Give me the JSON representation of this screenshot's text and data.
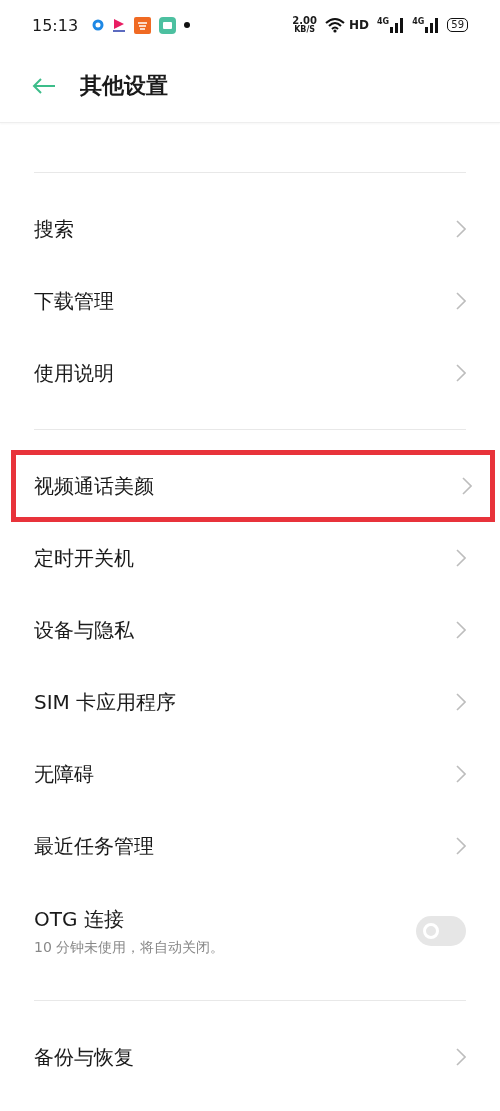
{
  "status_bar": {
    "time": "15:13",
    "speed": "2.00",
    "speed_unit": "KB/S",
    "hd": "HD",
    "sim1": "4G",
    "sim2": "4G",
    "battery": "59"
  },
  "header": {
    "title": "其他设置"
  },
  "sections": [
    {
      "items": [
        {
          "kind": "link",
          "label": "搜索",
          "highlighted": false
        },
        {
          "kind": "link",
          "label": "下载管理",
          "highlighted": false
        },
        {
          "kind": "link",
          "label": "使用说明",
          "highlighted": false
        }
      ]
    },
    {
      "items": [
        {
          "kind": "link",
          "label": "视频通话美颜",
          "highlighted": true
        },
        {
          "kind": "link",
          "label": "定时开关机",
          "highlighted": false
        },
        {
          "kind": "link",
          "label": "设备与隐私",
          "highlighted": false
        },
        {
          "kind": "link",
          "label": "SIM 卡应用程序",
          "highlighted": false
        },
        {
          "kind": "link",
          "label": "无障碍",
          "highlighted": false
        },
        {
          "kind": "link",
          "label": "最近任务管理",
          "highlighted": false
        },
        {
          "kind": "toggle",
          "label": "OTG 连接",
          "subtitle": "10 分钟未使用，将自动关闭。",
          "on": false
        }
      ]
    },
    {
      "items": [
        {
          "kind": "link",
          "label": "备份与恢复",
          "highlighted": false
        }
      ]
    }
  ]
}
